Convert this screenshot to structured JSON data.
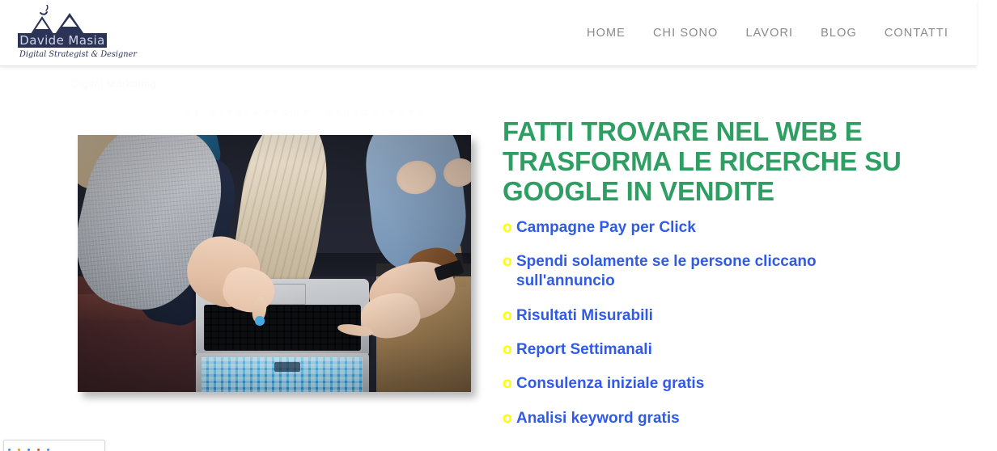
{
  "header": {
    "brand": {
      "name": "Davide Masia",
      "tagline": "Digital Strategist & Designer",
      "logo_icon": "mountain-logo-icon",
      "bird_icon": "bird-icon"
    },
    "nav": [
      {
        "label": "HOME"
      },
      {
        "label": "CHI SONO"
      },
      {
        "label": "LAVORI"
      },
      {
        "label": "BLOG"
      },
      {
        "label": "CONTATTI"
      }
    ]
  },
  "hero": {
    "title": "FATTI TROVARE NEL WEB E TRASFORMA LE RICERCHE SU GOOGLE IN VENDITE",
    "image_alt": "photo-people-around-laptop",
    "bullet_glyph": "o",
    "benefits": [
      {
        "label": "Campagne Pay per Click"
      },
      {
        "label": "Spendi solamente se le persone cliccano sull'annuncio"
      },
      {
        "label": "Risultati Misurabili"
      },
      {
        "label": "Report Settimanali"
      },
      {
        "label": "Consulenza iniziale gratis"
      },
      {
        "label": "Analisi keyword gratis"
      }
    ]
  },
  "background": {
    "watermark_1": "Digital Marketing",
    "watermark_2": "s t r a t e g i a   w e b   p e r   l a   t u a   a z i e n d a"
  },
  "colors": {
    "heading_green": "#2f9e63",
    "benefit_blue": "#2f5be8",
    "bullet_yellow": "#ffff00",
    "nav_gray": "#8a8a8a",
    "brand_navy": "#2b3356",
    "page_background": "#ffffff"
  }
}
